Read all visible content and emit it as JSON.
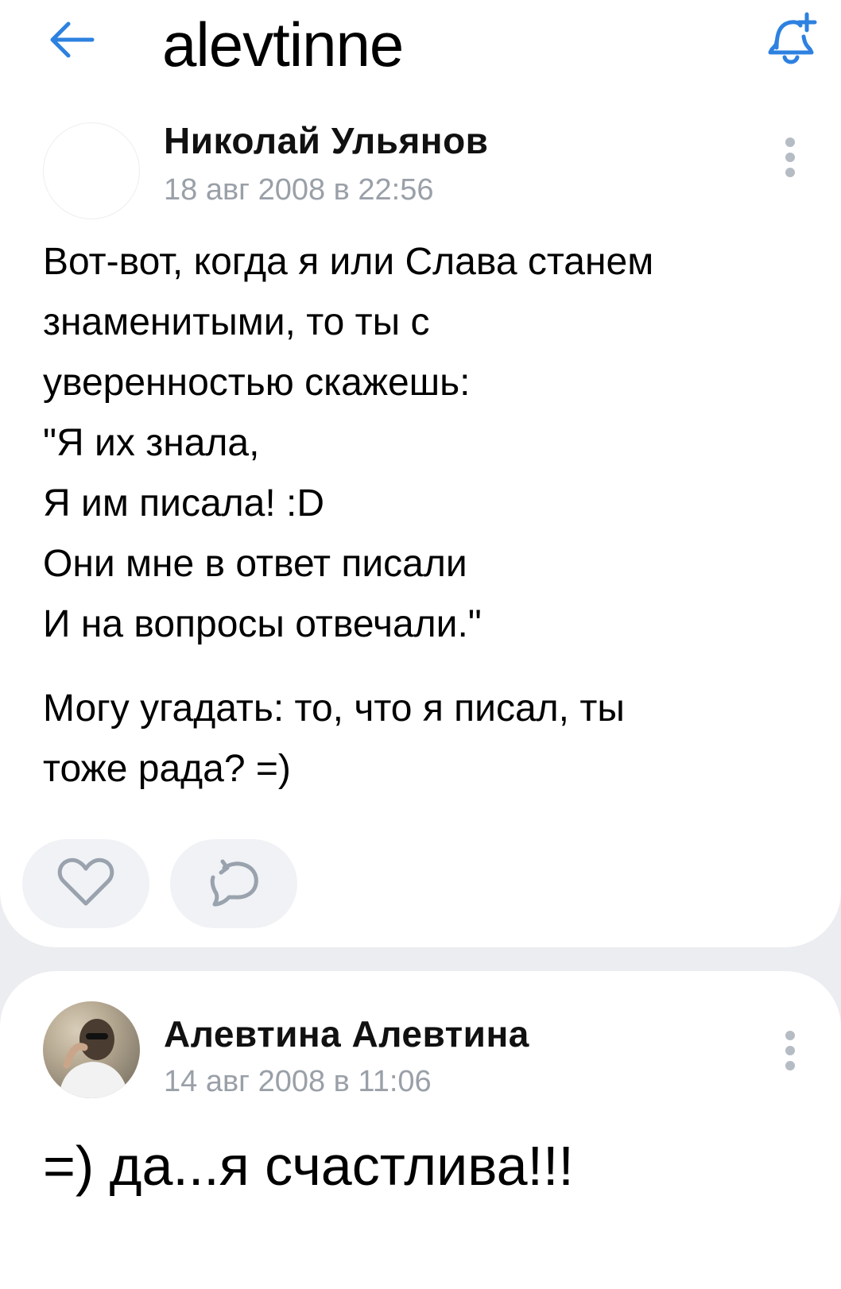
{
  "header": {
    "title": "alevtinne",
    "back_icon": "arrow-left-icon",
    "bell_icon": "bell-plus-icon",
    "accent_color": "#2d81e0"
  },
  "post": {
    "author": "Николай Ульянов",
    "date": "18 авг 2008 в 22:56",
    "text_lines": [
      "Вот-вот, когда я или Слава станем",
      "знаменитыми, то ты с",
      "уверенностью скажешь:",
      "\"Я их знала,",
      "Я им писала! :D",
      "Они мне в ответ писали",
      "И на вопросы отвечали.\"",
      "",
      "Могу угадать: то, что я писал, ты",
      "тоже рада? =)"
    ],
    "actions": {
      "like_icon": "heart-icon",
      "share_icon": "share-icon"
    }
  },
  "reply": {
    "author": "Алевтина Алевтина",
    "date": "14 авг 2008 в 11:06",
    "text": "=) да...я счастлива!!!"
  }
}
